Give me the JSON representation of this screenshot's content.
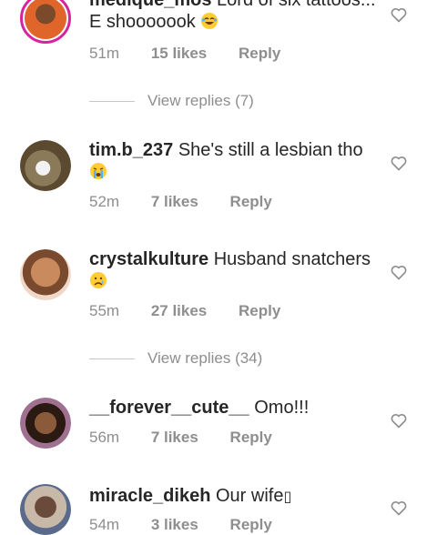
{
  "comments": [
    {
      "username": "medique_mos",
      "text": "Lord of six tattoos... E shooooook",
      "emoji": "laughing-emoji",
      "time": "51m",
      "likes": "15 likes",
      "reply": "Reply",
      "view_replies": "View replies (7)"
    },
    {
      "username": "tim.b_237",
      "text": "She's still a lesbian tho",
      "emoji": "crying-emoji",
      "time": "52m",
      "likes": "7 likes",
      "reply": "Reply"
    },
    {
      "username": "crystalkulture",
      "text": "Husband snatchers",
      "emoji": "crying-face-emoji",
      "time": "55m",
      "likes": "27 likes",
      "reply": "Reply",
      "view_replies": "View replies (34)"
    },
    {
      "username": "__forever__cute__",
      "text": "Omo!!!",
      "time": "56m",
      "likes": "7 likes",
      "reply": "Reply"
    },
    {
      "username": "miracle_dikeh",
      "text": "Our wife",
      "trailing_glyph": "▯",
      "time": "54m",
      "likes": "3 likes",
      "reply": "Reply"
    }
  ],
  "colors": {
    "text": "#262626",
    "meta": "#8e8e8e",
    "story_ring": "#d6249f"
  }
}
